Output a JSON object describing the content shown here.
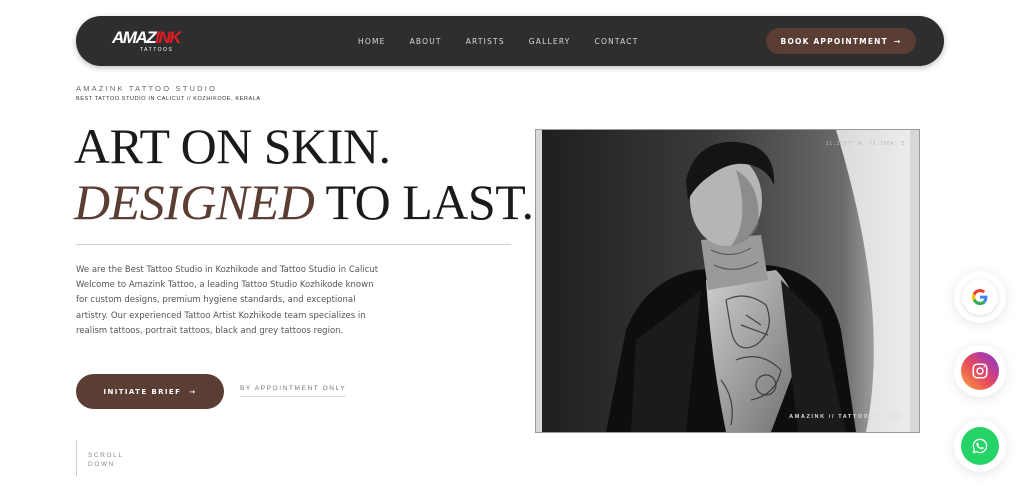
{
  "nav": {
    "logo_main": "AMAZ",
    "logo_accent": "INK",
    "logo_sub": "TATTOOS",
    "links": [
      "HOME",
      "ABOUT",
      "ARTISTS",
      "GALLERY",
      "CONTACT"
    ],
    "book_label": "BOOK APPOINTMENT",
    "arrow": "→"
  },
  "hero": {
    "studio_name": "AMAZINK TATTOO STUDIO",
    "studio_tag": "BEST TATTOO STUDIO IN CALICUT // KOZHIKODE, KERALA",
    "headline_line1": "ART ON SKIN.",
    "headline_em": "DESIGNED",
    "headline_rest": " TO LAST.",
    "intro": "We are the Best Tattoo Studio in Kozhikode and Tattoo Studio in Calicut Welcome to Amazink Tattoo, a leading Tattoo Studio Kozhikode known for custom designs, premium hygiene standards, and exceptional artistry. Our experienced Tattoo Artist Kozhikode team specializes in realism tattoos, portrait tattoos, black and grey tattoos region.",
    "initiate_label": "INITIATE BRIEF",
    "arrow": "→",
    "appointment_only": "BY APPOINTMENT ONLY",
    "scroll_text": "SCROLL DOWN"
  },
  "image": {
    "coords": "11.2587° N, 75.7804° E",
    "caption": "AMAZINK // TATTOO STUDIO"
  },
  "floating": {
    "icons": [
      "google-icon",
      "instagram-icon",
      "whatsapp-icon"
    ]
  },
  "colors": {
    "accent": "#5a3d33",
    "nav_bg": "#2e2e2e",
    "logo_red": "#e31b23"
  }
}
